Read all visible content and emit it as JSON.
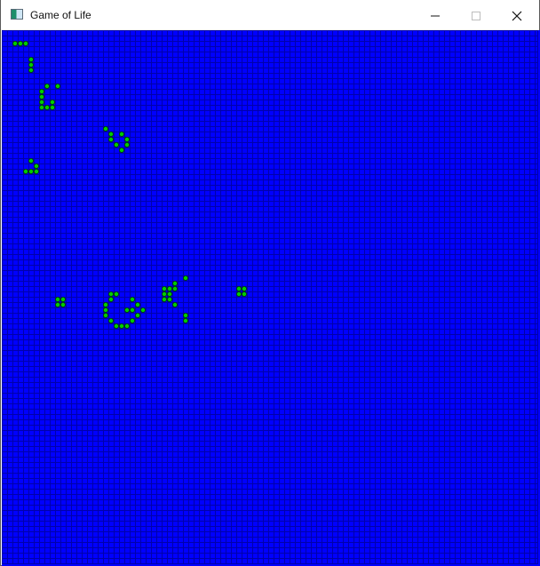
{
  "window": {
    "title": "Game of Life",
    "icon": "window-app-icon"
  },
  "titlebar": {
    "controls": [
      {
        "name": "minimize-button",
        "icon": "minimize-icon"
      },
      {
        "name": "maximize-button",
        "icon": "maximize-icon"
      },
      {
        "name": "close-button",
        "icon": "close-icon"
      }
    ]
  },
  "board": {
    "columns": 101,
    "rows": 100,
    "background_color": "#0000ff",
    "grid_line_color": "#0000aa",
    "live_cell_color": "#00cc00",
    "live_cell_outline": "#003300",
    "live_cells": [
      [
        2,
        2
      ],
      [
        3,
        2
      ],
      [
        4,
        2
      ],
      [
        5,
        5
      ],
      [
        5,
        6
      ],
      [
        5,
        7
      ],
      [
        8,
        10
      ],
      [
        10,
        10
      ],
      [
        7,
        11
      ],
      [
        7,
        12
      ],
      [
        7,
        13
      ],
      [
        9,
        13
      ],
      [
        7,
        14
      ],
      [
        8,
        14
      ],
      [
        9,
        14
      ],
      [
        19,
        18
      ],
      [
        20,
        19
      ],
      [
        22,
        19
      ],
      [
        20,
        20
      ],
      [
        23,
        20
      ],
      [
        21,
        21
      ],
      [
        23,
        21
      ],
      [
        22,
        22
      ],
      [
        5,
        24
      ],
      [
        6,
        25
      ],
      [
        4,
        26
      ],
      [
        5,
        26
      ],
      [
        6,
        26
      ],
      [
        34,
        46
      ],
      [
        32,
        47
      ],
      [
        30,
        48
      ],
      [
        31,
        48
      ],
      [
        32,
        48
      ],
      [
        44,
        48
      ],
      [
        45,
        48
      ],
      [
        20,
        49
      ],
      [
        21,
        49
      ],
      [
        30,
        49
      ],
      [
        31,
        49
      ],
      [
        44,
        49
      ],
      [
        45,
        49
      ],
      [
        10,
        50
      ],
      [
        11,
        50
      ],
      [
        20,
        50
      ],
      [
        24,
        50
      ],
      [
        30,
        50
      ],
      [
        31,
        50
      ],
      [
        10,
        51
      ],
      [
        11,
        51
      ],
      [
        19,
        51
      ],
      [
        25,
        51
      ],
      [
        32,
        51
      ],
      [
        19,
        52
      ],
      [
        23,
        52
      ],
      [
        24,
        52
      ],
      [
        26,
        52
      ],
      [
        19,
        53
      ],
      [
        25,
        53
      ],
      [
        34,
        53
      ],
      [
        20,
        54
      ],
      [
        24,
        54
      ],
      [
        34,
        54
      ],
      [
        21,
        55
      ],
      [
        22,
        55
      ],
      [
        23,
        55
      ]
    ]
  }
}
